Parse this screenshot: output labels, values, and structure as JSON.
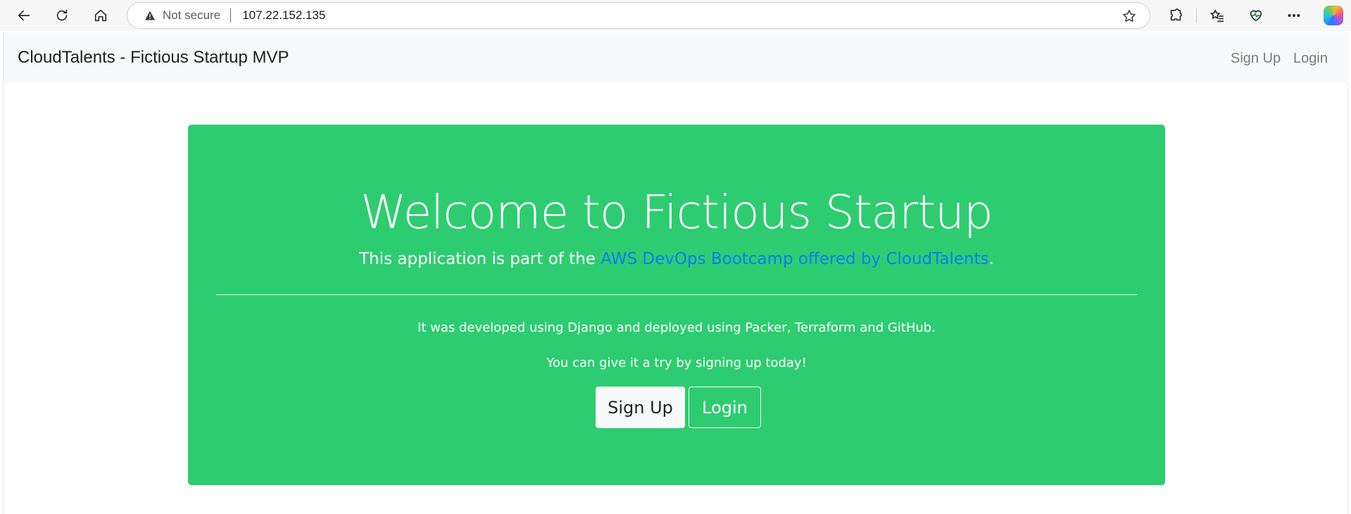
{
  "browser": {
    "security_label": "Not secure",
    "url": "107.22.152.135",
    "icons": {
      "back": "back-arrow-icon",
      "refresh": "refresh-icon",
      "home": "home-icon",
      "warning": "warning-icon",
      "favorite": "star-icon",
      "extensions": "puzzle-icon",
      "favorites": "favorites-icon",
      "performance": "heart-pulse-icon",
      "more": "more-dots-icon",
      "copilot": "copilot-icon"
    }
  },
  "navbar": {
    "brand": "CloudTalents - Fictious Startup MVP",
    "links": [
      "Sign Up",
      "Login"
    ]
  },
  "jumbotron": {
    "heading": "Welcome to Fictious Startup",
    "lead_prefix": "This application is part of the ",
    "lead_link": "AWS DevOps Bootcamp offered by CloudTalents",
    "lead_suffix": ".",
    "paragraph1": "It was developed using Django and deployed using Packer, Terraform and GitHub.",
    "paragraph2": "You can give it a try by signing up today!",
    "signup_button": "Sign Up",
    "login_button": "Login"
  },
  "colors": {
    "jumbotron_bg": "#2ecc71",
    "link": "#0d7cf2",
    "navbar_bg": "#f8f9fa"
  }
}
